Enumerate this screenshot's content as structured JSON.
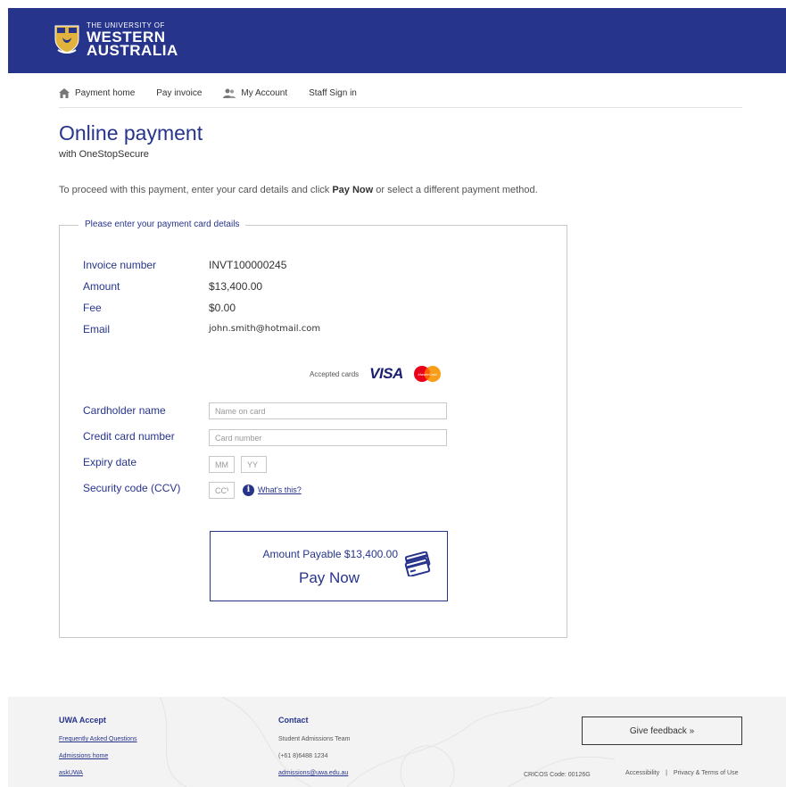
{
  "brand": {
    "line1": "THE UNIVERSITY OF",
    "line2": "WESTERN",
    "line3": "AUSTRALIA"
  },
  "nav": {
    "items": [
      {
        "label": "Payment home",
        "icon": "home-icon"
      },
      {
        "label": "Pay invoice",
        "icon": ""
      },
      {
        "label": "My Account",
        "icon": "user-icon"
      },
      {
        "label": "Staff Sign in",
        "icon": ""
      }
    ]
  },
  "page": {
    "title": "Online payment",
    "subtitle": "with OneStopSecure",
    "intro_before": "To proceed with this payment, enter your card details and click ",
    "intro_bold": "Pay Now",
    "intro_after": " or select a different payment method."
  },
  "form": {
    "legend": "Please enter your payment card details",
    "summary": [
      {
        "label": "Invoice number",
        "value": "INVT100000245"
      },
      {
        "label": "Amount",
        "value": "$13,400.00"
      },
      {
        "label": "Fee",
        "value": "$0.00"
      },
      {
        "label": "Email",
        "value": "john.smith@hotmail.com"
      }
    ],
    "accepted_cards_label": "Accepted cards",
    "visa_label": "VISA",
    "mastercard_label": "MasterCard",
    "cardholder_label": "Cardholder name",
    "cardholder_placeholder": "Name on card",
    "card_number_label": "Credit card number",
    "card_number_placeholder": "Card number",
    "expiry_label": "Expiry date",
    "expiry_month_placeholder": "MM",
    "expiry_year_placeholder": "YY",
    "security_label": "Security code (CCV)",
    "security_placeholder": "CCV",
    "info_glyph": "i",
    "whats_this": "What's this?",
    "pay_amount": "Amount Payable $13,400.00",
    "pay_now": "Pay Now"
  },
  "footer": {
    "col1_title": "UWA Accept",
    "col1_links": [
      "Frequently Asked Questions",
      "Admissions home",
      "askUWA"
    ],
    "col2_title": "Contact",
    "col2_team": "Student Admissions Team",
    "col2_phone": "(+61 8)6488 1234",
    "col2_email": "admissions@uwa.edu.au",
    "cricos": "CRICOS Code: 00126G",
    "feedback": "Give feedback »",
    "accessibility": "Accessibility",
    "separator": "|",
    "privacy": "Privacy & Terms of Use"
  },
  "colors": {
    "brand_blue": "#27348b",
    "footer_bg": "#f3f3f3",
    "gold": "#e2b33c"
  }
}
